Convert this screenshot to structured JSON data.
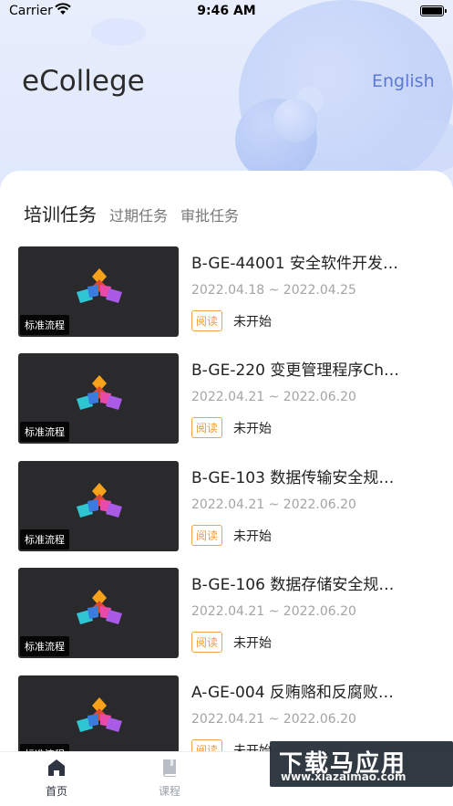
{
  "status_bar": {
    "carrier": "Carrier",
    "time": "9:46 AM"
  },
  "header": {
    "app_title": "eCollege",
    "language": "English"
  },
  "tabs": [
    {
      "label": "培训任务",
      "active": true
    },
    {
      "label": "过期任务",
      "active": false
    },
    {
      "label": "审批任务",
      "active": false
    }
  ],
  "courses": [
    {
      "title": "B-GE-44001 安全软件开发…",
      "dates": "2022.04.18 ~ 2022.04.25",
      "badge": "阅读",
      "status": "未开始",
      "tag": "标准流程"
    },
    {
      "title": "B-GE-220 变更管理程序Ch…",
      "dates": "2022.04.21 ~ 2022.06.20",
      "badge": "阅读",
      "status": "未开始",
      "tag": "标准流程"
    },
    {
      "title": "B-GE-103 数据传输安全规…",
      "dates": "2022.04.21 ~ 2022.06.20",
      "badge": "阅读",
      "status": "未开始",
      "tag": "标准流程"
    },
    {
      "title": "B-GE-106 数据存储安全规…",
      "dates": "2022.04.21 ~ 2022.06.20",
      "badge": "阅读",
      "status": "未开始",
      "tag": "标准流程"
    },
    {
      "title": "A-GE-004 反贿赂和反腐败…",
      "dates": "2022.04.21 ~ 2022.06.20",
      "badge": "阅读",
      "status": "未开始",
      "tag": "标准流程"
    }
  ],
  "tab_bar": {
    "home_label": "首页",
    "course_label": "课程"
  },
  "watermark": {
    "big": "下载马应用",
    "small": "www.xiazaimao.com"
  },
  "colors": {
    "accent": "#5b79d6",
    "badge": "#f09a3a"
  }
}
